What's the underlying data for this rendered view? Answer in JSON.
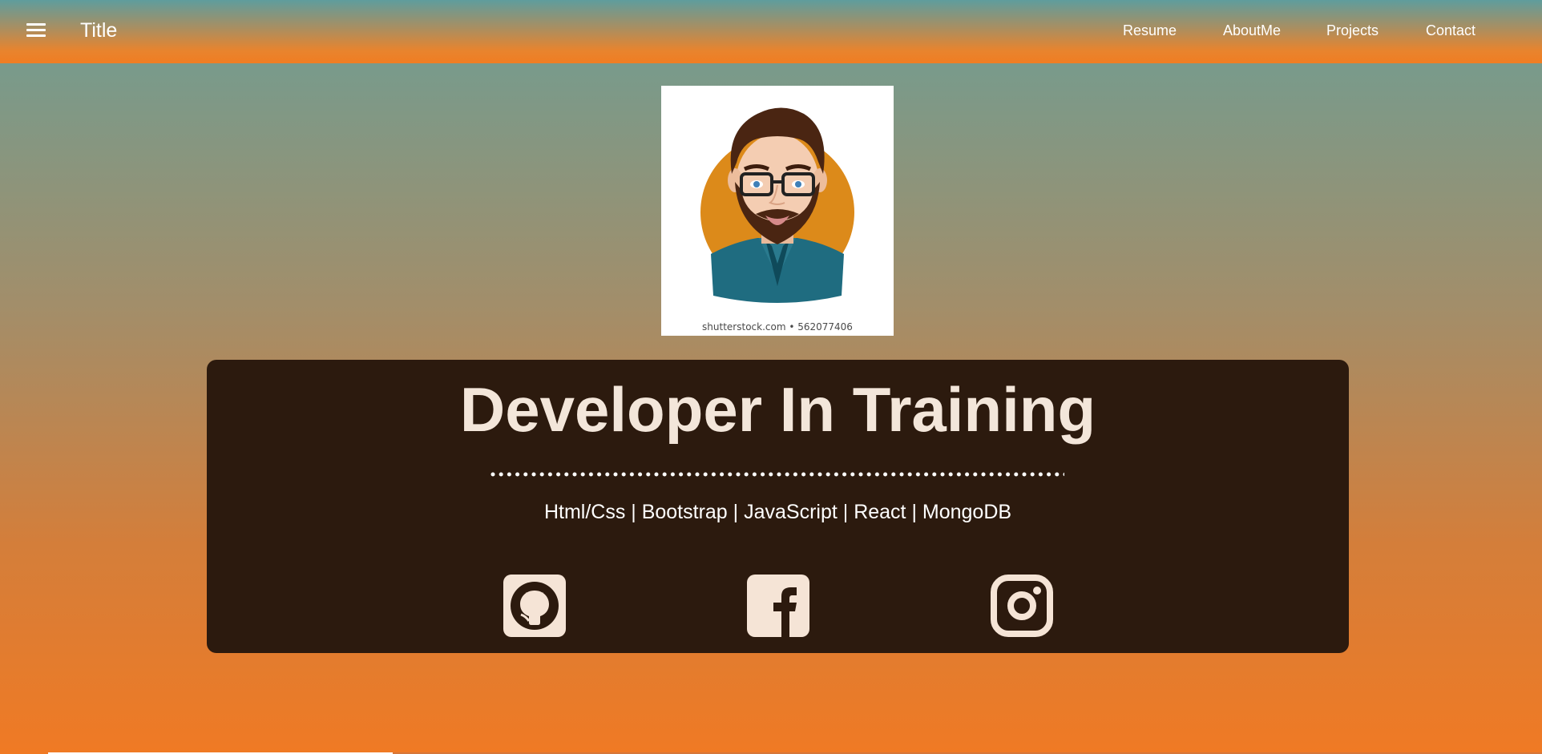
{
  "navbar": {
    "brand": "Title",
    "links": [
      "Resume",
      "AboutMe",
      "Projects",
      "Contact"
    ]
  },
  "avatar": {
    "caption": "shutterstock.com • 562077406"
  },
  "hero": {
    "title": "Developer In Training",
    "skills": "Html/Css | Bootstrap | JavaScript | React | MongoDB"
  },
  "social": [
    {
      "name": "github-icon"
    },
    {
      "name": "facebook-icon"
    },
    {
      "name": "instagram-icon"
    }
  ],
  "colors": {
    "hero_bg": "#2c1a0e",
    "hero_text": "#f3e6da",
    "icon_fill": "#f5e4d6",
    "accent_orange": "#f07d22"
  }
}
